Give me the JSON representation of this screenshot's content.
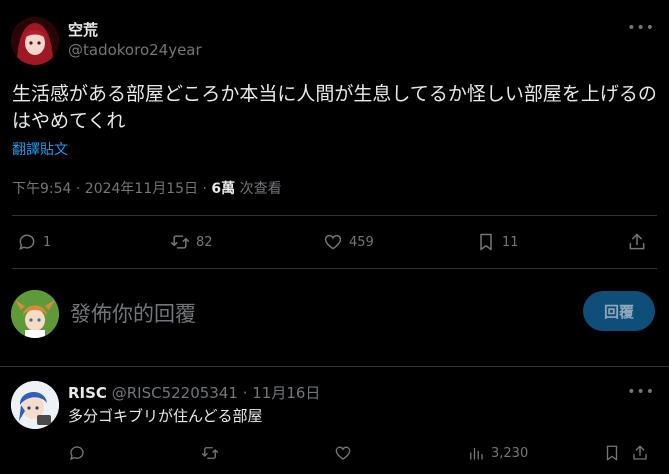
{
  "tweet": {
    "display_name": "空荒",
    "handle": "@tadokoro24year",
    "text": "生活感がある部屋どころか本当に人間が生息してるか怪しい部屋を上げるのはやめてくれ",
    "translate_label": "翻譯貼文",
    "timestamp": "下午9:54 · 2024年11月15日 · ",
    "views_count": "6萬",
    "views_label": " 次查看",
    "replies": "1",
    "retweets": "82",
    "likes": "459",
    "bookmarks": "11"
  },
  "compose": {
    "placeholder": "發佈你的回覆",
    "button_label": "回覆"
  },
  "reply": {
    "display_name": "RISC",
    "handle": "@RISC52205341 · 11月16日",
    "text": "多分ゴキブリが住んどる部屋",
    "views": "3,230"
  },
  "icons": {
    "more": "more-horizontal-icon",
    "reply": "reply-icon",
    "retweet": "retweet-icon",
    "like": "heart-icon",
    "bookmark": "bookmark-icon",
    "share": "share-icon",
    "views": "views-icon"
  },
  "colors": {
    "background": "#000000",
    "text": "#e7e9ea",
    "muted": "#71767b",
    "accent": "#1d9bf0",
    "divider": "#2f3336",
    "reply_button": "#0f4e78"
  }
}
